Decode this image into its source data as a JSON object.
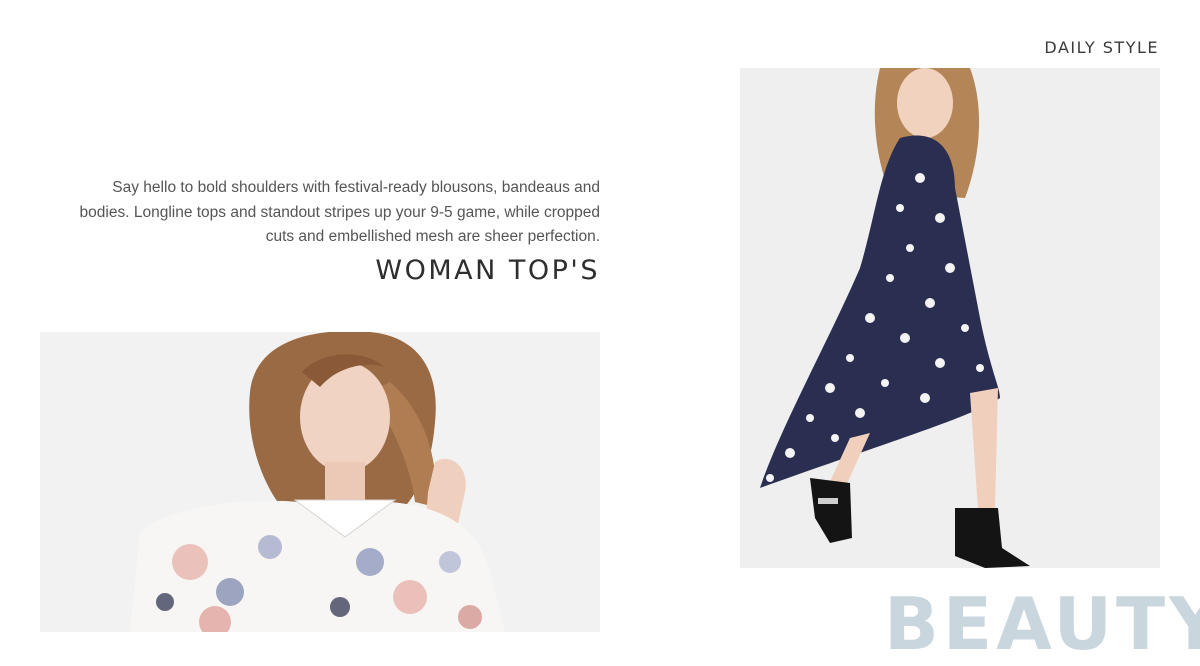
{
  "sidebar_label": "DAILY STYLE",
  "intro_text": "Say hello to bold shoulders with festival-ready blousons, bandeaus and bodies. Longline tops and standout stripes up your 9-5 game, while cropped cuts and embellished mesh are sheer perfection.",
  "section_title": "WOMAN TOP'S",
  "next_section_title": "BEAUTY",
  "colors": {
    "text_dark": "#2e2e2e",
    "text_body": "#555555",
    "beauty_accent": "#c9d6dd"
  }
}
